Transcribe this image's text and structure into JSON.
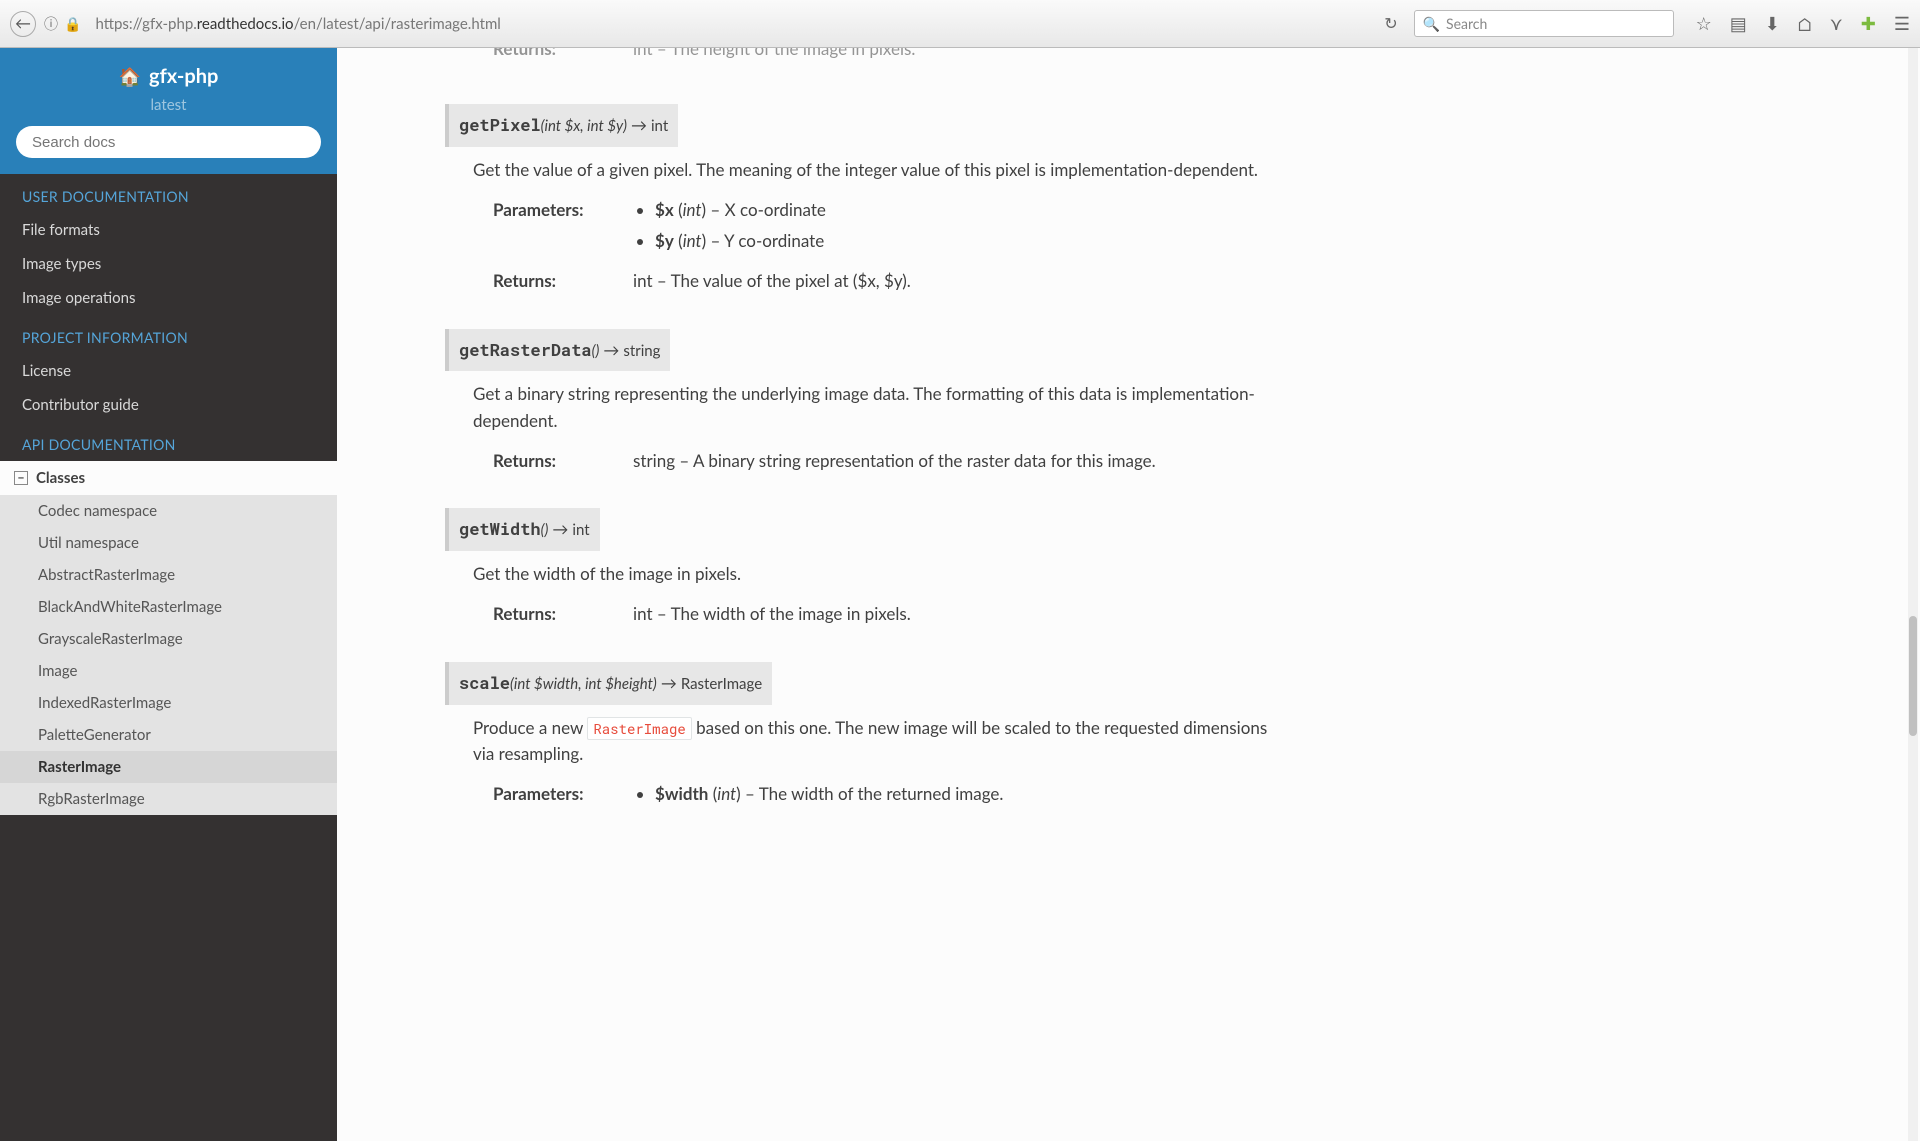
{
  "browser": {
    "url_pre": "https://gfx-php.",
    "url_domain": "readthedocs.io",
    "url_path": "/en/latest/api/rasterimage.html",
    "search_placeholder": "Search"
  },
  "sidebar": {
    "project": "gfx-php",
    "version": "latest",
    "search_placeholder": "Search docs",
    "sections": [
      {
        "caption": "USER DOCUMENTATION",
        "items": [
          "File formats",
          "Image types",
          "Image operations"
        ]
      },
      {
        "caption": "PROJECT INFORMATION",
        "items": [
          "License",
          "Contributor guide"
        ]
      },
      {
        "caption": "API DOCUMENTATION",
        "items": [],
        "current": {
          "label": "Classes",
          "children": [
            "Codec namespace",
            "Util namespace",
            "AbstractRasterImage",
            "BlackAndWhiteRasterImage",
            "GrayscaleRasterImage",
            "Image",
            "IndexedRasterImage",
            "PaletteGenerator",
            "RasterImage",
            "RgbRasterImage"
          ],
          "active_child": "RasterImage"
        }
      }
    ]
  },
  "content": {
    "partial_top": {
      "returns_label": "Returns:",
      "returns_text": "int – The height of the image in pixels."
    },
    "methods": [
      {
        "name": "getPixel",
        "params": "(int $x, int $y)",
        "ret": "int",
        "desc": "Get the value of a given pixel. The meaning of the integer value of this pixel is implementation-dependent.",
        "param_label": "Parameters:",
        "params_list": [
          {
            "var": "$x",
            "type": "int",
            "desc": "X co-ordinate"
          },
          {
            "var": "$y",
            "type": "int",
            "desc": "Y co-ordinate"
          }
        ],
        "returns_label": "Returns:",
        "returns_text": "int – The value of the pixel at ($x, $y)."
      },
      {
        "name": "getRasterData",
        "params": "()",
        "ret": "string",
        "desc": "Get a binary string representing the underlying image data. The formatting of this data is implementation-dependent.",
        "returns_label": "Returns:",
        "returns_text": "string – A binary string representation of the raster data for this image."
      },
      {
        "name": "getWidth",
        "params": "()",
        "ret": "int",
        "desc": "Get the width of the image in pixels.",
        "returns_label": "Returns:",
        "returns_text": "int – The width of the image in pixels."
      },
      {
        "name": "scale",
        "params": "(int $width, int $height)",
        "ret": "RasterImage",
        "desc_pre": "Produce a new ",
        "desc_code": "RasterImage",
        "desc_post": " based on this one. The new image will be scaled to the requested dimensions via resampling.",
        "param_label": "Parameters:",
        "params_list": [
          {
            "var": "$width",
            "type": "int",
            "desc": "The width of the returned image."
          }
        ]
      }
    ]
  }
}
